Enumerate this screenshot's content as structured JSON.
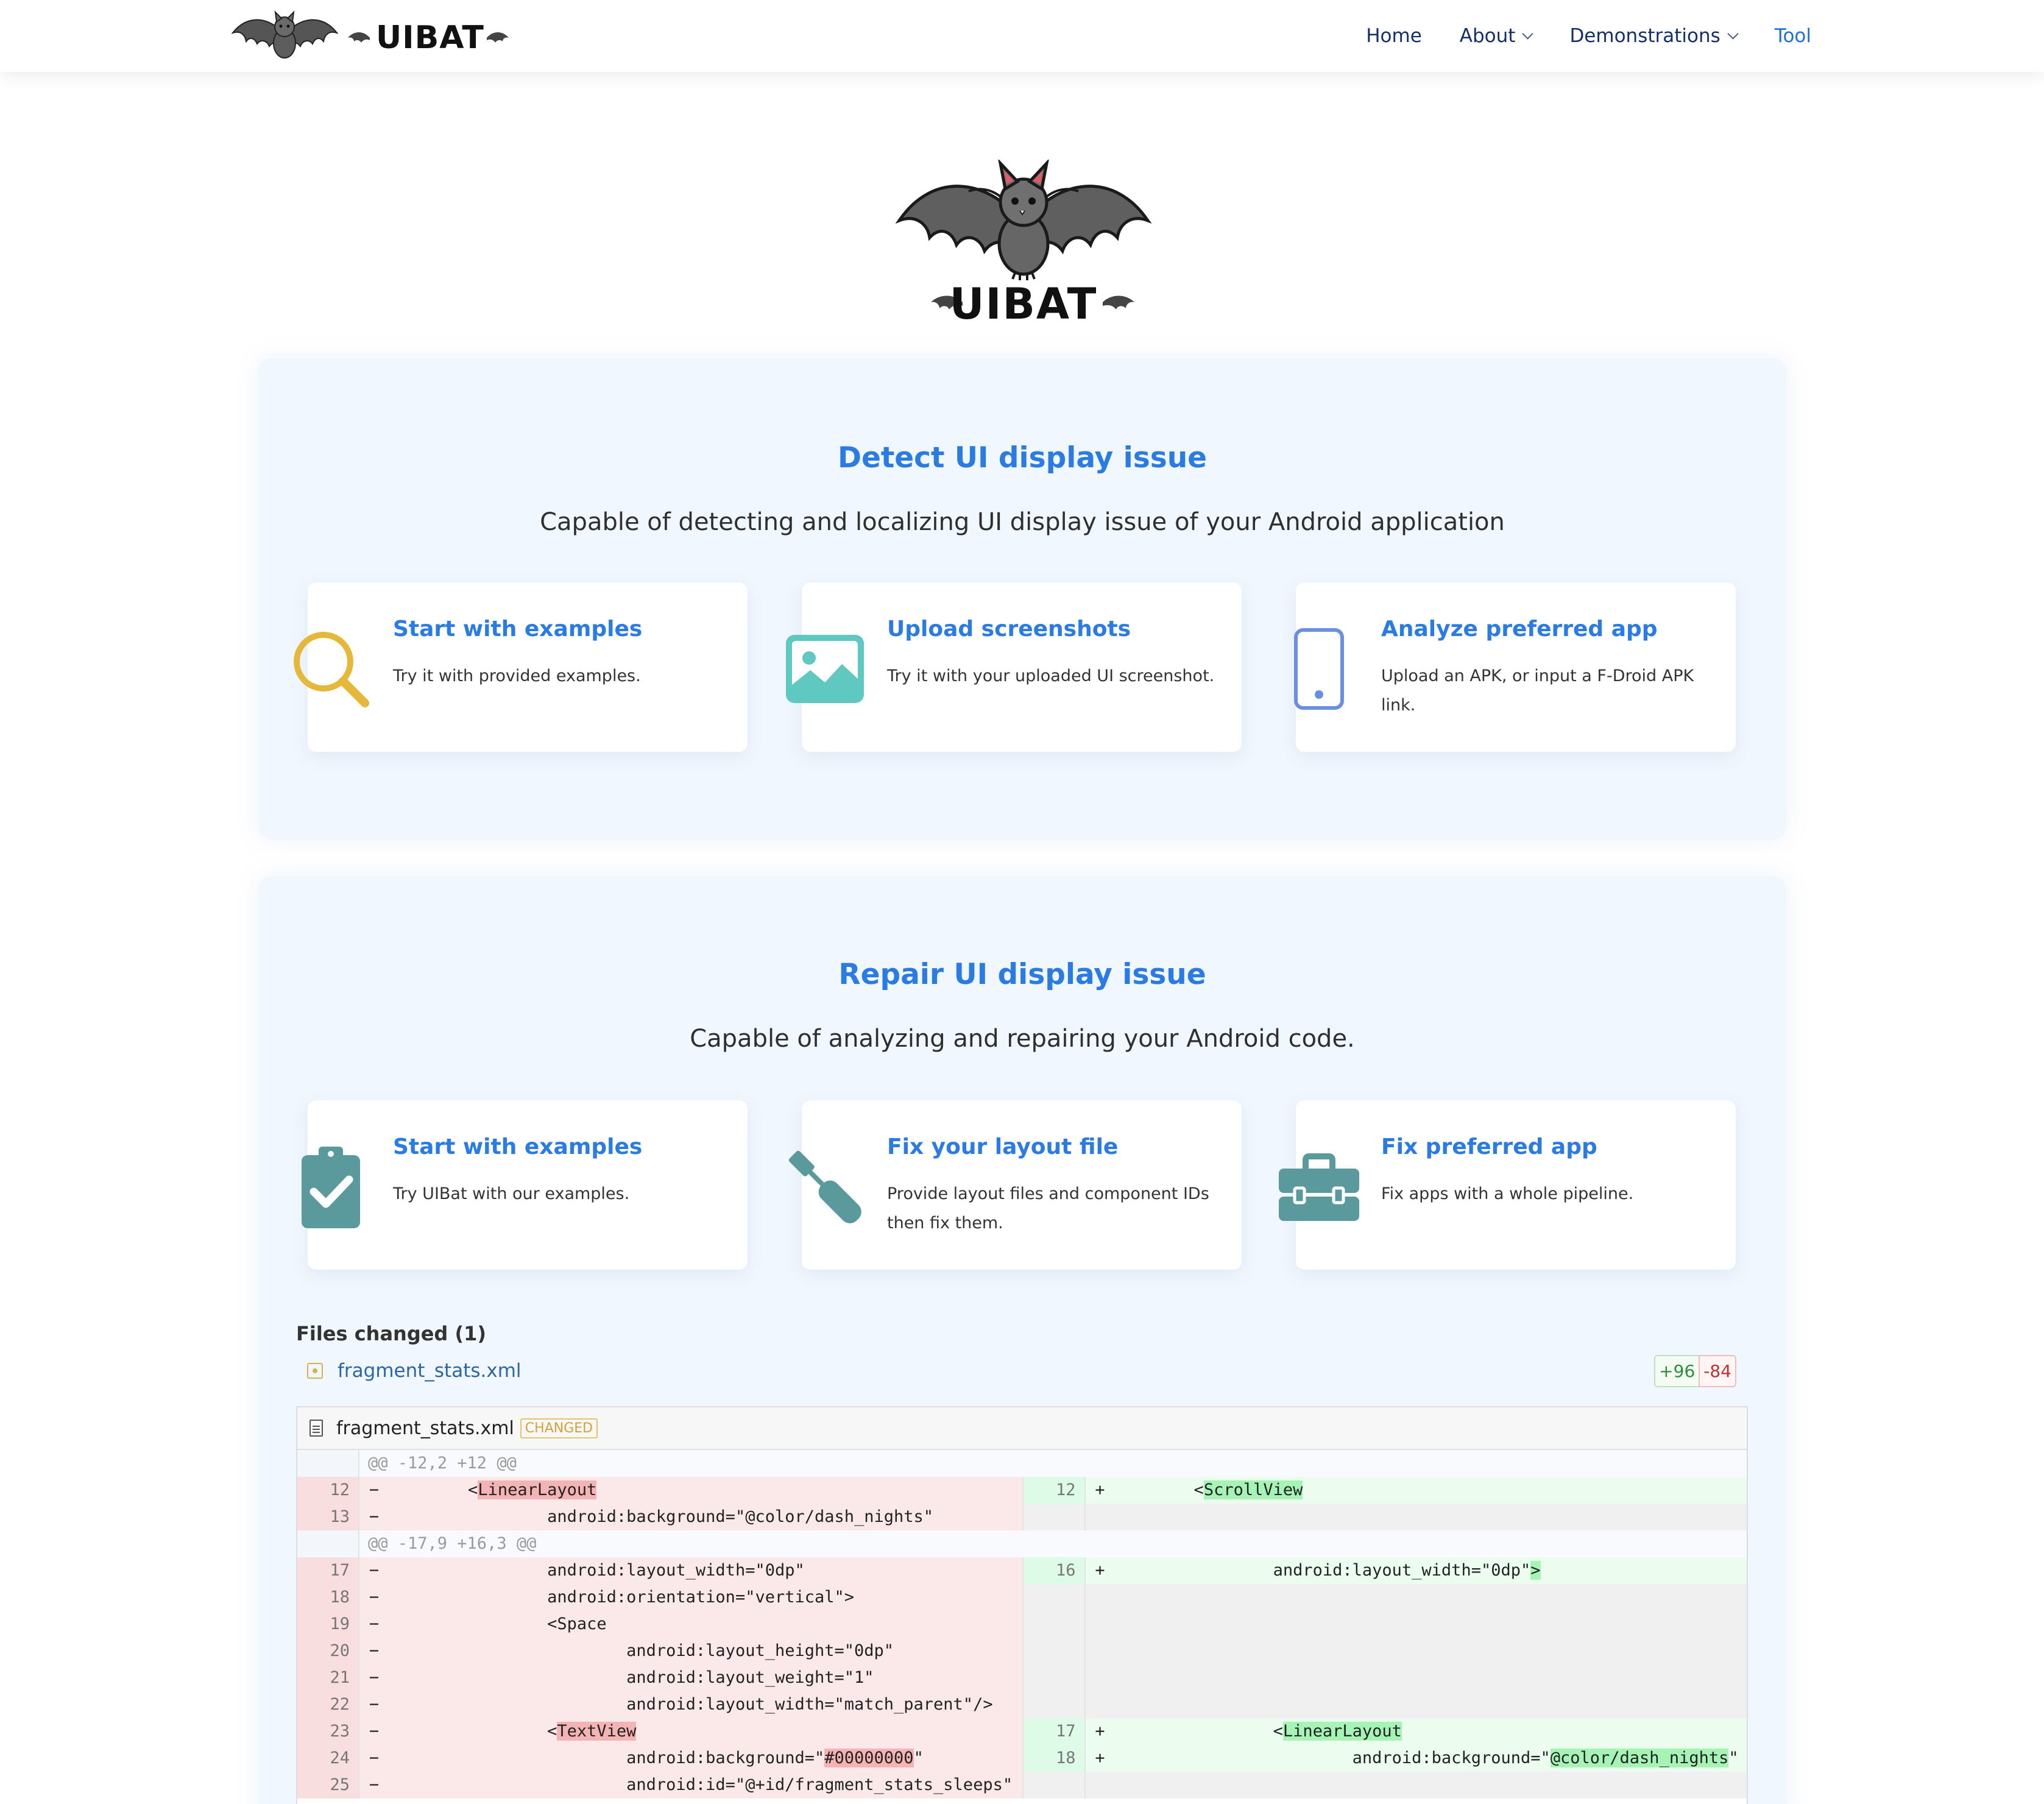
{
  "brand": {
    "name": "UIBAT"
  },
  "nav": {
    "items": [
      {
        "label": "Home",
        "dropdown": false,
        "active": false
      },
      {
        "label": "About",
        "dropdown": true,
        "active": false
      },
      {
        "label": "Demonstrations",
        "dropdown": true,
        "active": false
      },
      {
        "label": "Tool",
        "dropdown": false,
        "active": true
      }
    ]
  },
  "hero": {
    "logo_text": "UIBAT"
  },
  "detect": {
    "title": "Detect UI display issue",
    "subtitle": "Capable of detecting and localizing UI display issue of your Android application",
    "cards": [
      {
        "icon": "magnifier-icon",
        "title": "Start with examples",
        "desc": "Try it with provided examples."
      },
      {
        "icon": "image-icon",
        "title": "Upload screenshots",
        "desc": "Try it with your uploaded UI screenshot."
      },
      {
        "icon": "phone-icon",
        "title": "Analyze preferred app",
        "desc": "Upload an APK, or input a F-Droid APK link."
      }
    ]
  },
  "repair": {
    "title": "Repair UI display issue",
    "subtitle": "Capable of analyzing and repairing your Android code.",
    "cards": [
      {
        "icon": "clipboard-check-icon",
        "title": "Start with examples",
        "desc": "Try UIBat with our examples."
      },
      {
        "icon": "screwdriver-icon",
        "title": "Fix your layout file",
        "desc": "Provide layout files and component IDs then fix them."
      },
      {
        "icon": "toolbox-icon",
        "title": "Fix preferred app",
        "desc": "Fix apps with a whole pipeline."
      }
    ]
  },
  "files": {
    "title": "Files changed (1)",
    "file": "fragment_stats.xml",
    "additions": "+96",
    "deletions": "-84",
    "badge": "CHANGED"
  },
  "diff_rows": [
    {
      "type": "hunk",
      "text": "@@ -12,2 +12 @@"
    },
    {
      "type": "pair",
      "l": {
        "n": "12",
        "m": "−",
        "pre": "        <",
        "hl": "LinearLayout",
        "post": ""
      },
      "r": {
        "n": "12",
        "m": "+",
        "pre": "        <",
        "hl": "ScrollView",
        "post": ""
      }
    },
    {
      "type": "pair",
      "l": {
        "n": "13",
        "m": "−",
        "pre": "                android:background=\"@color/dash_nights\"",
        "hl": "",
        "post": ""
      },
      "r": null
    },
    {
      "type": "hunk",
      "text": "@@ -17,9 +16,3 @@"
    },
    {
      "type": "pair",
      "l": {
        "n": "17",
        "m": "−",
        "pre": "                android:layout_width=\"0dp\"",
        "hl": "",
        "post": ""
      },
      "r": {
        "n": "16",
        "m": "+",
        "pre": "                android:layout_width=\"0dp\"",
        "hl": ">",
        "post": ""
      }
    },
    {
      "type": "pair",
      "l": {
        "n": "18",
        "m": "−",
        "pre": "                android:orientation=\"vertical\">",
        "hl": "",
        "post": ""
      },
      "r": null
    },
    {
      "type": "pair",
      "l": {
        "n": "19",
        "m": "−",
        "pre": "                <Space",
        "hl": "",
        "post": ""
      },
      "r": null
    },
    {
      "type": "pair",
      "l": {
        "n": "20",
        "m": "−",
        "pre": "                        android:layout_height=\"0dp\"",
        "hl": "",
        "post": ""
      },
      "r": null
    },
    {
      "type": "pair",
      "l": {
        "n": "21",
        "m": "−",
        "pre": "                        android:layout_weight=\"1\"",
        "hl": "",
        "post": ""
      },
      "r": null
    },
    {
      "type": "pair",
      "l": {
        "n": "22",
        "m": "−",
        "pre": "                        android:layout_width=\"match_parent\"/>",
        "hl": "",
        "post": ""
      },
      "r": null
    },
    {
      "type": "pair",
      "l": {
        "n": "23",
        "m": "−",
        "pre": "                <",
        "hl": "TextView",
        "post": ""
      },
      "r": {
        "n": "17",
        "m": "+",
        "pre": "                <",
        "hl": "LinearLayout",
        "post": ""
      }
    },
    {
      "type": "pair",
      "l": {
        "n": "24",
        "m": "−",
        "pre": "                        android:background=\"",
        "hl": "#00000000",
        "post": "\""
      },
      "r": {
        "n": "18",
        "m": "+",
        "pre": "                        android:background=\"",
        "hl": "@color/dash_nights",
        "post": "\""
      }
    },
    {
      "type": "pair",
      "l": {
        "n": "25",
        "m": "−",
        "pre": "                        android:id=\"@+id/fragment_stats_sleeps\"",
        "hl": "",
        "post": ""
      },
      "r": null
    }
  ],
  "colors": {
    "accent": "#2a7be4",
    "nav_text": "#13306b",
    "section_bg": "#f1f7fe"
  }
}
